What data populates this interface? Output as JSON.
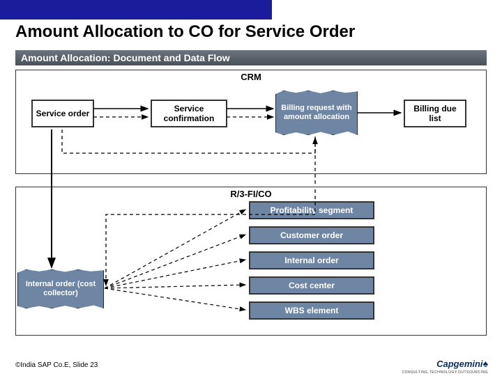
{
  "title": "Amount Allocation to CO for Service Order",
  "subtitle": "Amount Allocation:  Document and Data Flow",
  "crm": {
    "label": "CRM",
    "service_order": "Service order",
    "service_confirmation": "Service confirmation",
    "billing_request": "Billing request with amount allocation",
    "billing_due_list": "Billing due list"
  },
  "r3": {
    "label": "R/3-FI/CO",
    "items": [
      "Profitability segment",
      "Customer order",
      "Internal order",
      "Cost center",
      "WBS element"
    ],
    "internal_order_flag": "Internal order (cost collector)"
  },
  "footer": "©India SAP Co.E, Slide 23",
  "brand": {
    "name": "Capgemini",
    "tag": "CONSULTING.TECHNOLOGY.OUTSOURCING"
  },
  "chart_data": {
    "type": "diagram",
    "title": "Amount Allocation: Document and Data Flow",
    "groups": [
      {
        "name": "CRM",
        "nodes": [
          "Service order",
          "Service confirmation",
          "Billing request with amount allocation",
          "Billing due list"
        ]
      },
      {
        "name": "R/3-FI/CO",
        "nodes": [
          "Profitability segment",
          "Customer order",
          "Internal order",
          "Cost center",
          "WBS element",
          "Internal order (cost collector)"
        ]
      }
    ],
    "edges": [
      {
        "from": "Service order",
        "to": "Service confirmation",
        "style": "solid"
      },
      {
        "from": "Service order",
        "to": "Service confirmation",
        "style": "dashed"
      },
      {
        "from": "Service confirmation",
        "to": "Billing request with amount allocation",
        "style": "solid"
      },
      {
        "from": "Service confirmation",
        "to": "Billing request with amount allocation",
        "style": "dashed"
      },
      {
        "from": "Service order",
        "to": "Billing request with amount allocation",
        "style": "dashed"
      },
      {
        "from": "Billing request with amount allocation",
        "to": "Billing due list",
        "style": "solid"
      },
      {
        "from": "Service order",
        "to": "Internal order (cost collector)",
        "style": "solid"
      },
      {
        "from": "Billing request with amount allocation",
        "to": "Internal order (cost collector)",
        "style": "dashed"
      },
      {
        "from": "Internal order (cost collector)",
        "to": "Profitability segment",
        "style": "dashed"
      },
      {
        "from": "Internal order (cost collector)",
        "to": "Customer order",
        "style": "dashed"
      },
      {
        "from": "Internal order (cost collector)",
        "to": "Internal order",
        "style": "dashed"
      },
      {
        "from": "Internal order (cost collector)",
        "to": "Cost center",
        "style": "dashed"
      },
      {
        "from": "Internal order (cost collector)",
        "to": "WBS element",
        "style": "dashed"
      }
    ]
  }
}
